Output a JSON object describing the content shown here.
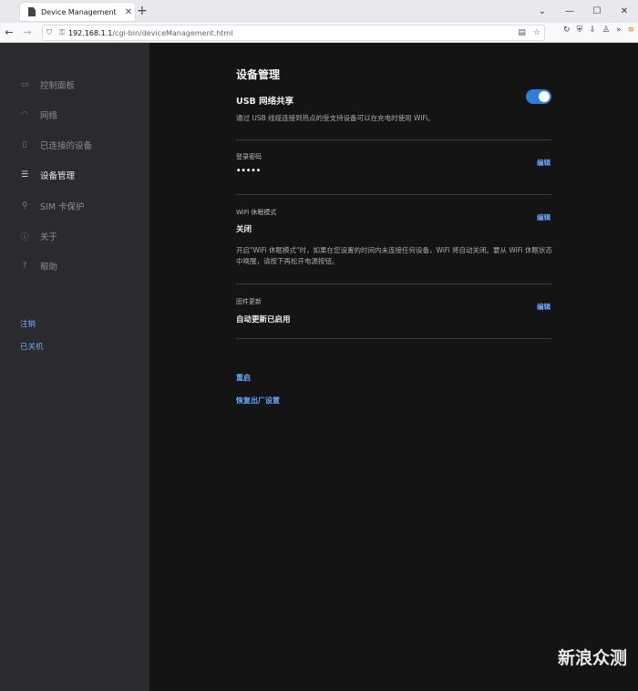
{
  "browser": {
    "tab_title": "Device Management",
    "tab_close": "✕",
    "new_tab": "+",
    "url_host": "192.168.1.1",
    "url_path": "/cgi-bin/deviceManagement.html"
  },
  "sidebar": {
    "items": [
      {
        "label": "控制面板",
        "icon": "dashboard-icon"
      },
      {
        "label": "网络",
        "icon": "wifi-icon"
      },
      {
        "label": "已连接的设备",
        "icon": "device-icon"
      },
      {
        "label": "设备管理",
        "icon": "sliders-icon"
      },
      {
        "label": "SIM 卡保护",
        "icon": "lock-icon"
      },
      {
        "label": "关于",
        "icon": "info-icon"
      },
      {
        "label": "帮助",
        "icon": "help-icon"
      }
    ],
    "logout": "注销",
    "shutdown": "已关机"
  },
  "main": {
    "title": "设备管理",
    "usb_label": "USB 网络共享",
    "usb_desc": "通过 USB 线缆连接到热点的受支持设备可以在充电时使用 WiFi。",
    "usb_enabled": true,
    "password_label": "登录密码",
    "password_value": "•••••",
    "sleep_label": "WiFi 休眠模式",
    "sleep_value": "关闭",
    "sleep_desc": "开启\"WiFi 休眠模式\"时，如果在您设置的时间内未连接任何设备，WiFi 将自动关闭。要从 WiFi 休眠状态中唤醒，请按下再松开电源按钮。",
    "firmware_label": "固件更新",
    "firmware_value": "自动更新已启用",
    "edit_label": "编辑",
    "restart": "重启",
    "factory_reset": "恢复出厂设置"
  },
  "watermark": {
    "big": "新浪众测",
    "small": ""
  },
  "colors": {
    "accent": "#2e7fdb",
    "link": "#6aa8ff",
    "sidebar_bg": "#2b2b2d",
    "main_bg": "#141414"
  }
}
